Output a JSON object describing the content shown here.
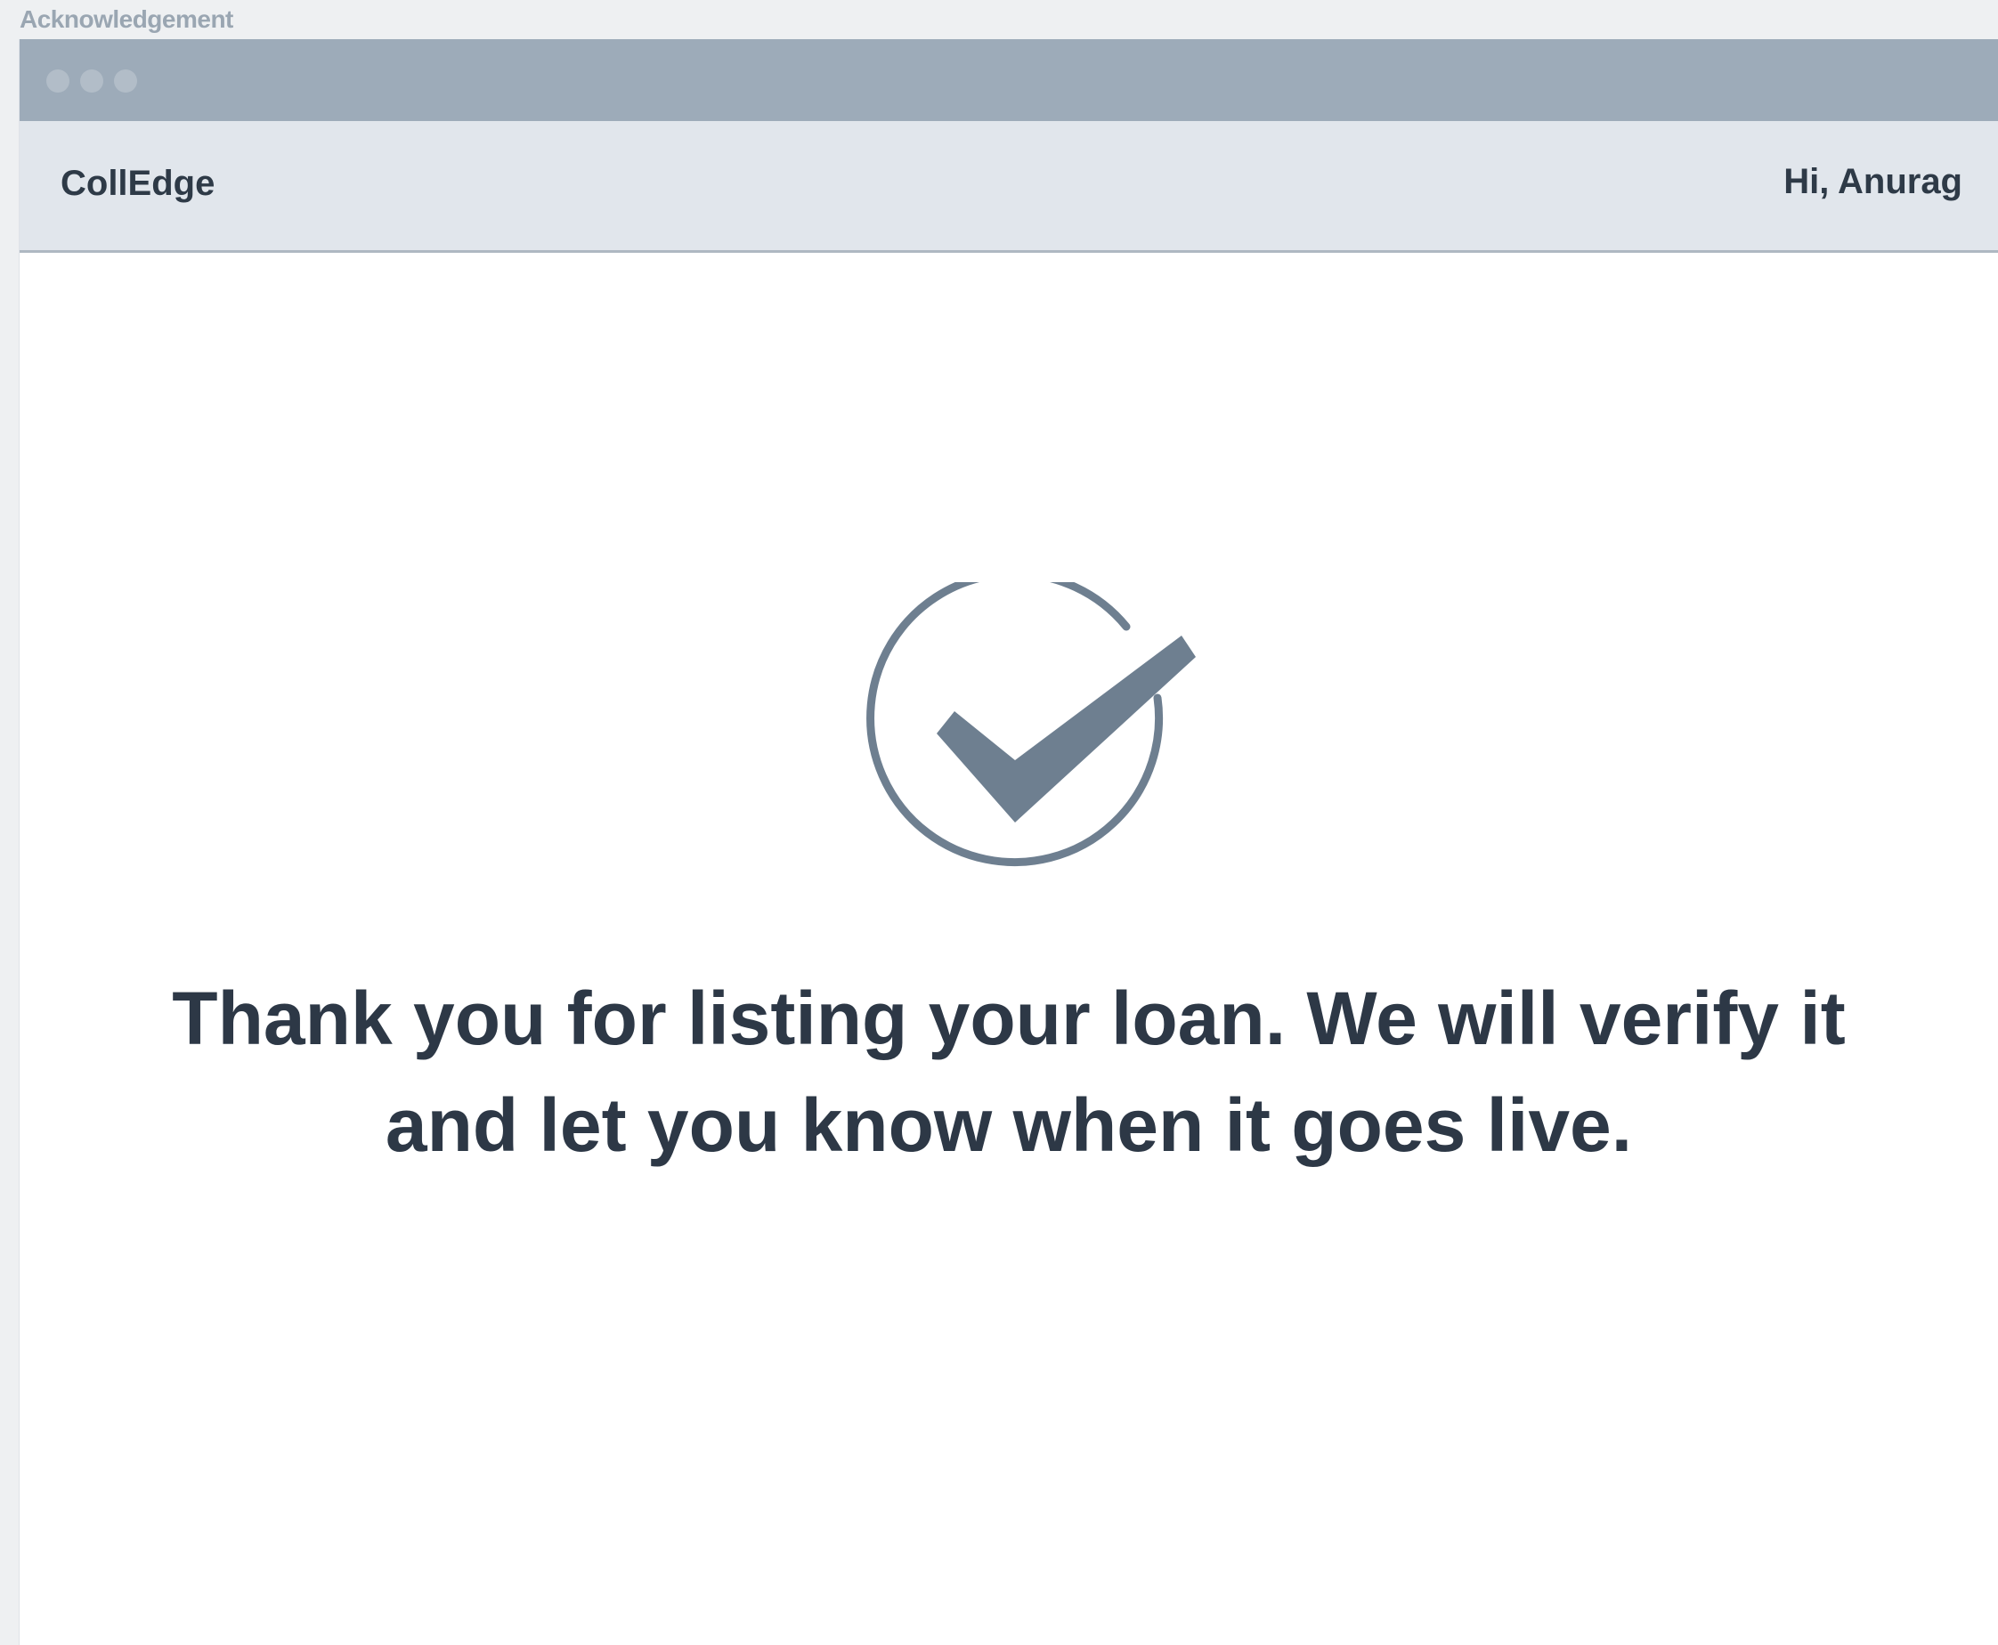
{
  "page": {
    "caption": "Acknowledgement"
  },
  "window": {
    "dots": [
      "window-dot-close",
      "window-dot-minimize",
      "window-dot-maximize"
    ]
  },
  "header": {
    "brand": "CollEdge",
    "greeting": "Hi, Anurag"
  },
  "confirmation": {
    "icon": "check-circle-icon",
    "message_line_1": "Thank you for listing your loan. We will verify it",
    "message_line_2": "and let you know when it goes live."
  },
  "colors": {
    "title_bar": "#9dabb9",
    "header_bg": "#e1e6ec",
    "icon": "#6e7f90",
    "text": "#2d3846"
  }
}
